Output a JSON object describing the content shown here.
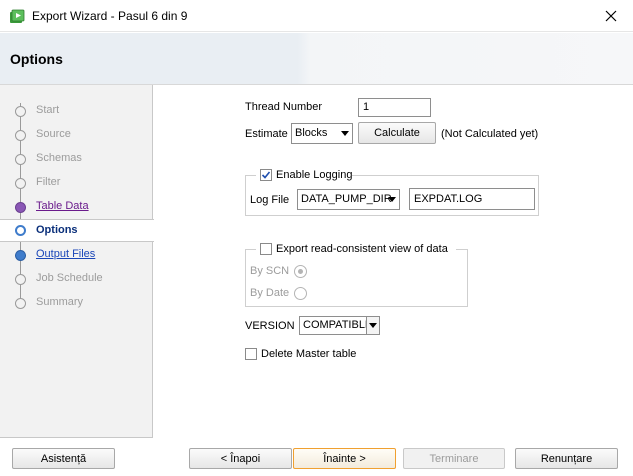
{
  "window": {
    "title": "Export Wizard - Pasul 6 din 9"
  },
  "header": {
    "title": "Options"
  },
  "steps": [
    {
      "label": "Start",
      "state": "disabled"
    },
    {
      "label": "Source",
      "state": "disabled"
    },
    {
      "label": "Schemas",
      "state": "disabled"
    },
    {
      "label": "Filter",
      "state": "disabled"
    },
    {
      "label": "Table Data",
      "state": "visited-link"
    },
    {
      "label": "Options",
      "state": "current"
    },
    {
      "label": "Output Files",
      "state": "link"
    },
    {
      "label": "Job Schedule",
      "state": "disabled"
    },
    {
      "label": "Summary",
      "state": "disabled"
    }
  ],
  "options": {
    "thread_number_label": "Thread Number",
    "thread_number_value": "1",
    "estimate_label": "Estimate",
    "estimate_value": "Blocks",
    "calculate_label": "Calculate",
    "calculate_status": "(Not Calculated yet)",
    "enable_logging_label": "Enable Logging",
    "enable_logging_checked": true,
    "log_file_label": "Log File",
    "log_dir_value": "DATA_PUMP_DIR",
    "log_file_value": "EXPDAT.LOG",
    "read_consistent_label": "Export read-consistent view of data",
    "read_consistent_checked": false,
    "by_scn_label": "By SCN",
    "by_date_label": "By Date",
    "version_label": "VERSION",
    "version_value": "COMPATIBLE",
    "delete_master_label": "Delete Master table",
    "delete_master_checked": false
  },
  "footer": {
    "help_label": "Asistență",
    "back_label": "< Înapoi",
    "next_label": "Înainte >",
    "finish_label": "Terminare",
    "cancel_label": "Renunțare"
  },
  "colors": {
    "accent": "#3f7ccb",
    "visited": "#6a1b8c",
    "focus": "#f0a030"
  }
}
